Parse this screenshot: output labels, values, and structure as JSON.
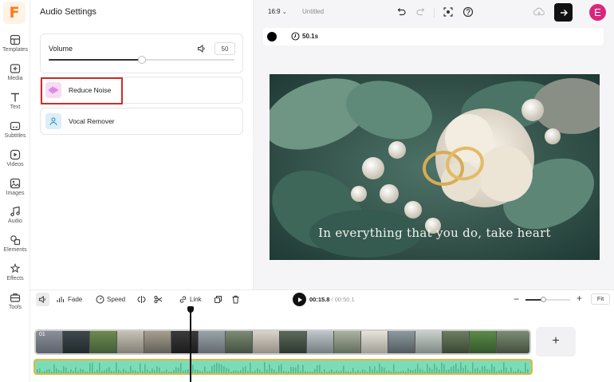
{
  "app": {
    "logo_letter": "F"
  },
  "rail": {
    "items": [
      {
        "label": "Templates",
        "icon": "templates-icon"
      },
      {
        "label": "Media",
        "icon": "media-icon"
      },
      {
        "label": "Text",
        "icon": "text-icon"
      },
      {
        "label": "Subtitles",
        "icon": "subtitles-icon"
      },
      {
        "label": "Videos",
        "icon": "videos-icon"
      },
      {
        "label": "Images",
        "icon": "images-icon"
      },
      {
        "label": "Audio",
        "icon": "audio-icon"
      },
      {
        "label": "Elements",
        "icon": "elements-icon"
      },
      {
        "label": "Effects",
        "icon": "effects-icon"
      },
      {
        "label": "Tools",
        "icon": "tools-icon"
      }
    ]
  },
  "panel": {
    "title": "Audio Settings",
    "volume": {
      "label": "Volume",
      "value": "50",
      "level_fraction": 0.5
    },
    "options": [
      {
        "label": "Reduce Noise",
        "icon": "waveform-icon",
        "highlighted": true
      },
      {
        "label": "Vocal Remover",
        "icon": "person-icon",
        "highlighted": false
      }
    ]
  },
  "topbar": {
    "aspect_ratio": "16:9",
    "project_name": "Untitled",
    "avatar_letter": "E",
    "avatar_color": "#d9267d"
  },
  "canvas": {
    "background_color": "#000000",
    "duration": "50.1s",
    "caption": "In everything that you do, take heart"
  },
  "timeline": {
    "tools": [
      {
        "label": "Fade"
      },
      {
        "label": "Speed"
      },
      {
        "label": "Link"
      }
    ],
    "current_time": "00:15.8",
    "total_time": "/ 00:50.1",
    "fit_label": "Fit",
    "zoom_minus": "−",
    "zoom_plus": "+",
    "add_clip_label": "+",
    "track_index": "01",
    "zoom_fraction": 0.4
  }
}
